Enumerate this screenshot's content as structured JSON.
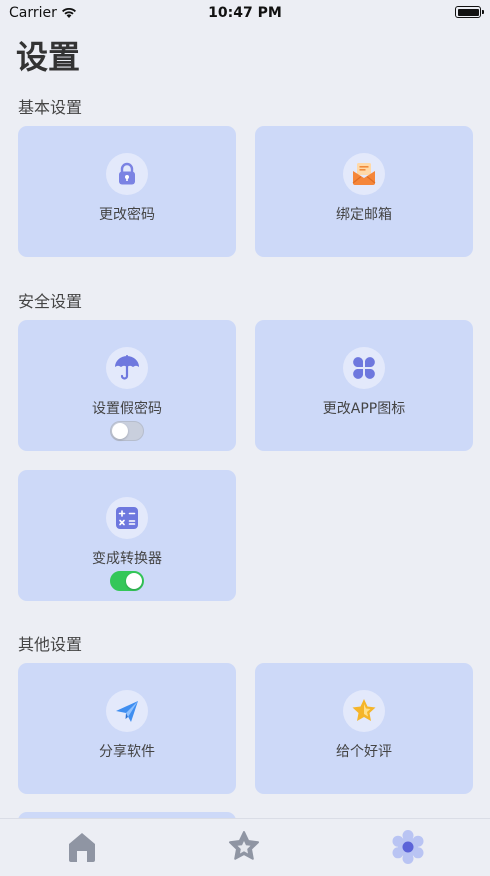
{
  "status_bar": {
    "carrier": "Carrier",
    "time": "10:47 PM"
  },
  "page_title": "设置",
  "sections": {
    "basic": {
      "title": "基本设置",
      "items": [
        {
          "label": "更改密码",
          "icon": "lock-icon"
        },
        {
          "label": "绑定邮箱",
          "icon": "mail-icon"
        }
      ]
    },
    "security": {
      "title": "安全设置",
      "items": [
        {
          "label": "设置假密码",
          "icon": "umbrella-icon",
          "toggle": false
        },
        {
          "label": "更改APP图标",
          "icon": "clover-icon"
        },
        {
          "label": "变成转换器",
          "icon": "calculator-icon",
          "toggle": true
        }
      ]
    },
    "other": {
      "title": "其他设置",
      "items": [
        {
          "label": "分享软件",
          "icon": "paper-plane-icon"
        },
        {
          "label": "给个好评",
          "icon": "star-icon"
        }
      ]
    }
  },
  "tab_bar": {
    "tabs": [
      {
        "icon": "home-icon",
        "active": false
      },
      {
        "icon": "star-icon",
        "active": false
      },
      {
        "icon": "gear-icon",
        "active": true
      }
    ]
  },
  "colors": {
    "card_bg": "#cdd9f8",
    "accent": "#6c7ee6",
    "toggle_on": "#34c759",
    "background": "#eceef4"
  }
}
